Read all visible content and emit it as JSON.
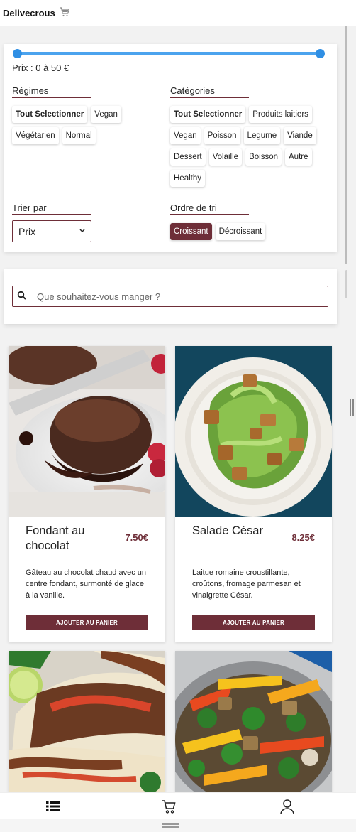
{
  "app": {
    "title": "Delivecrous",
    "cart_icon": "cart-icon"
  },
  "filters": {
    "price_label": "Prix : 0 à 50 €",
    "price_min": 0,
    "price_max": 50,
    "regimes": {
      "title": "Régimes",
      "chips": [
        "Tout Selectionner",
        "Vegan",
        "Végétarien",
        "Normal"
      ]
    },
    "categories": {
      "title": "Catégories",
      "chips": [
        "Tout Selectionner",
        "Produits laitiers",
        "Vegan",
        "Poisson",
        "Legume",
        "Viande",
        "Dessert",
        "Volaille",
        "Boisson",
        "Autre",
        "Healthy"
      ]
    },
    "sort": {
      "title": "Trier par",
      "selected": "Prix"
    },
    "order": {
      "title": "Ordre de tri",
      "options": [
        "Croissant",
        "Décroissant"
      ],
      "selected": "Croissant"
    }
  },
  "search": {
    "placeholder": "Que souhaitez-vous manger ?",
    "value": ""
  },
  "products": [
    {
      "name": "Fondant au chocolat",
      "price": "7.50€",
      "description": "Gâteau au chocolat chaud avec un centre fondant, surmonté de glace à la vanille.",
      "button": "AJOUTER AU PANIER"
    },
    {
      "name": "Salade César",
      "price": "8.25€",
      "description": "Laitue romaine croustillante, croûtons, fromage parmesan et vinaigrette César.",
      "button": "AJOUTER AU PANIER"
    },
    {
      "name": "",
      "price": "",
      "description": "",
      "button": ""
    },
    {
      "name": "",
      "price": "",
      "description": "",
      "button": ""
    }
  ],
  "nav": {
    "items": [
      "menu-list-icon",
      "cart-icon",
      "user-icon"
    ]
  },
  "colors": {
    "accent": "#6e2e38",
    "slider": "#4ba3ee"
  }
}
